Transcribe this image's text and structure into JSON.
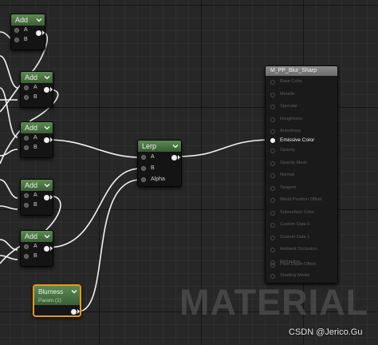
{
  "add_nodes": [
    {
      "title": "Add",
      "pin_a": "A",
      "pin_b": "B"
    },
    {
      "title": "Add",
      "pin_a": "A",
      "pin_b": "B"
    },
    {
      "title": "Add",
      "pin_a": "A",
      "pin_b": "B"
    },
    {
      "title": "Add",
      "pin_a": "A",
      "pin_b": "B"
    },
    {
      "title": "Add",
      "pin_a": "A",
      "pin_b": "B"
    }
  ],
  "lerp": {
    "title": "Lerp",
    "pin_a": "A",
    "pin_b": "B",
    "pin_alpha": "Alpha"
  },
  "param": {
    "title": "Blurness",
    "subtitle": "Param (1)"
  },
  "material": {
    "title": "M_PP_Blur_Sharp",
    "inputs": [
      "Base Color",
      "Metallic",
      "Specular",
      "Roughness",
      "Anisotropy",
      "Emissive Color",
      "Opacity",
      "Opacity Mask",
      "Normal",
      "Tangent",
      "World Position Offset",
      "Subsurface Color",
      "Custom Data 0",
      "Custom Data 1",
      "Ambient Occlusion",
      "Refraction",
      "Pixel Depth Offset",
      "Shading Model"
    ],
    "active_input": "Emissive Color"
  },
  "watermark": "MATERIAL",
  "credit": "CSDN @Jerico.Gu",
  "colors": {
    "node_header": "#4f7a46",
    "selection": "#e59a18",
    "wire": "#ffffff",
    "grid": "#272727"
  }
}
